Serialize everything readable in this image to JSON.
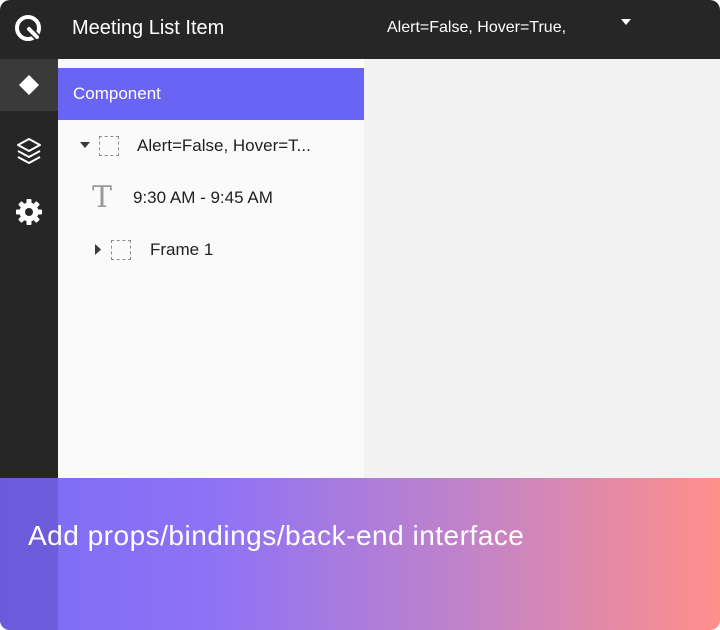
{
  "app": {
    "title": "Meeting List Item",
    "variant_selector": "Alert=False, Hover=True,"
  },
  "rail": {
    "items": [
      {
        "icon": "diamond-icon",
        "active": true
      },
      {
        "icon": "layers-icon",
        "active": false
      },
      {
        "icon": "gear-icon",
        "active": false
      }
    ]
  },
  "panel": {
    "header": "Component",
    "tree": [
      {
        "label": "Alert=False, Hover=T...",
        "type": "frame",
        "expanded": true
      },
      {
        "label": "9:30 AM - 9:45 AM",
        "type": "text"
      },
      {
        "label": "Frame 1",
        "type": "frame",
        "expanded": false
      }
    ]
  },
  "banner": {
    "text": "Add props/bindings/back-end interface"
  },
  "colors": {
    "topbar": "#262626",
    "accent": "#6a64f5",
    "gradient_start": "#7b6cf6",
    "gradient_end": "#ff8f8a"
  }
}
